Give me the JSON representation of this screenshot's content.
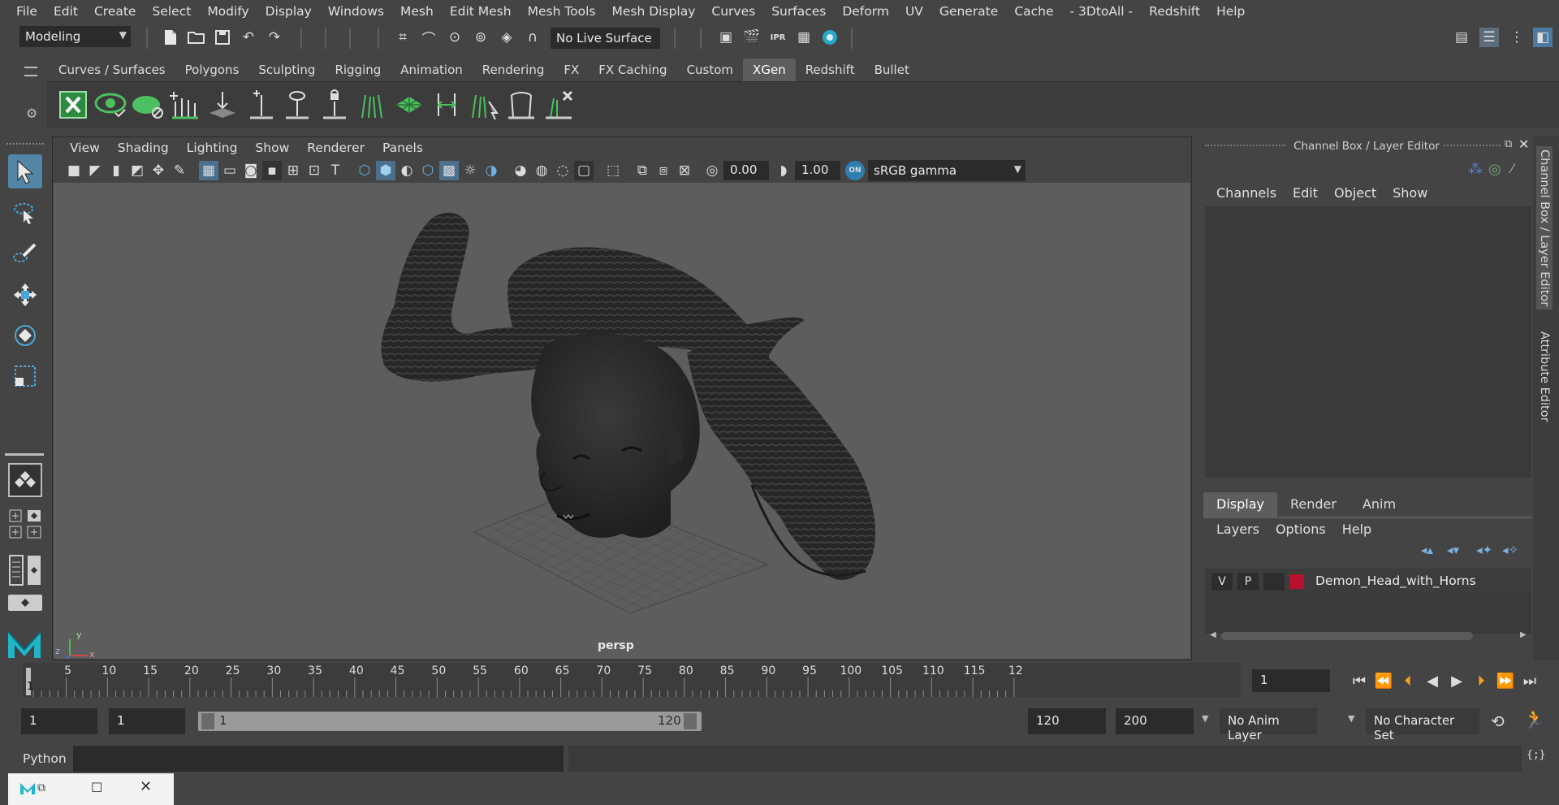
{
  "menubar": {
    "items": [
      "File",
      "Edit",
      "Create",
      "Select",
      "Modify",
      "Display",
      "Windows",
      "Mesh",
      "Edit Mesh",
      "Mesh Tools",
      "Mesh Display",
      "Curves",
      "Surfaces",
      "Deform",
      "UV",
      "Generate",
      "Cache",
      "- 3DtoAll -",
      "Redshift",
      "Help"
    ]
  },
  "statusline": {
    "mode": "Modeling",
    "live_surface": "No Live Surface"
  },
  "shelf": {
    "tabs": [
      "Curves / Surfaces",
      "Polygons",
      "Sculpting",
      "Rigging",
      "Animation",
      "Rendering",
      "FX",
      "FX Caching",
      "Custom",
      "XGen",
      "Redshift",
      "Bullet"
    ],
    "active_tab": "XGen"
  },
  "viewport": {
    "menu": [
      "View",
      "Shading",
      "Lighting",
      "Show",
      "Renderer",
      "Panels"
    ],
    "exposure": "0.00",
    "gamma": "1.00",
    "color_space": "sRGB gamma",
    "camera_label": "persp",
    "axis_x": "x",
    "axis_y": "y",
    "axis_z": "z"
  },
  "channel_box": {
    "title": "Channel Box / Layer Editor",
    "menu": [
      "Channels",
      "Edit",
      "Object",
      "Show"
    ]
  },
  "layer_editor": {
    "tabs": [
      "Display",
      "Render",
      "Anim"
    ],
    "active_tab": "Display",
    "menu": [
      "Layers",
      "Options",
      "Help"
    ],
    "layer": {
      "v": "V",
      "p": "P",
      "name": "Demon_Head_with_Horns",
      "color": "#b8102e"
    }
  },
  "side_tabs": [
    "Channel Box / Layer Editor",
    "Attribute Editor"
  ],
  "timeslider": {
    "ticks": [
      "5",
      "10",
      "15",
      "20",
      "25",
      "30",
      "35",
      "40",
      "45",
      "50",
      "55",
      "60",
      "65",
      "70",
      "75",
      "80",
      "85",
      "90",
      "95",
      "100",
      "105",
      "110",
      "115",
      "12"
    ],
    "current_marker": "1",
    "current_frame": "1"
  },
  "range": {
    "start": "1",
    "anim_start": "1",
    "range_start": "1",
    "range_end": "120",
    "end": "120",
    "anim_end": "200",
    "anim_layer": "No Anim Layer",
    "character_set": "No Character Set"
  },
  "cmdline": {
    "language": "Python"
  },
  "colors": {
    "accent": "#5285a6",
    "xgen_green": "#3fa05a",
    "bg": "#444444",
    "viewport_bg": "#5d5d5d"
  }
}
